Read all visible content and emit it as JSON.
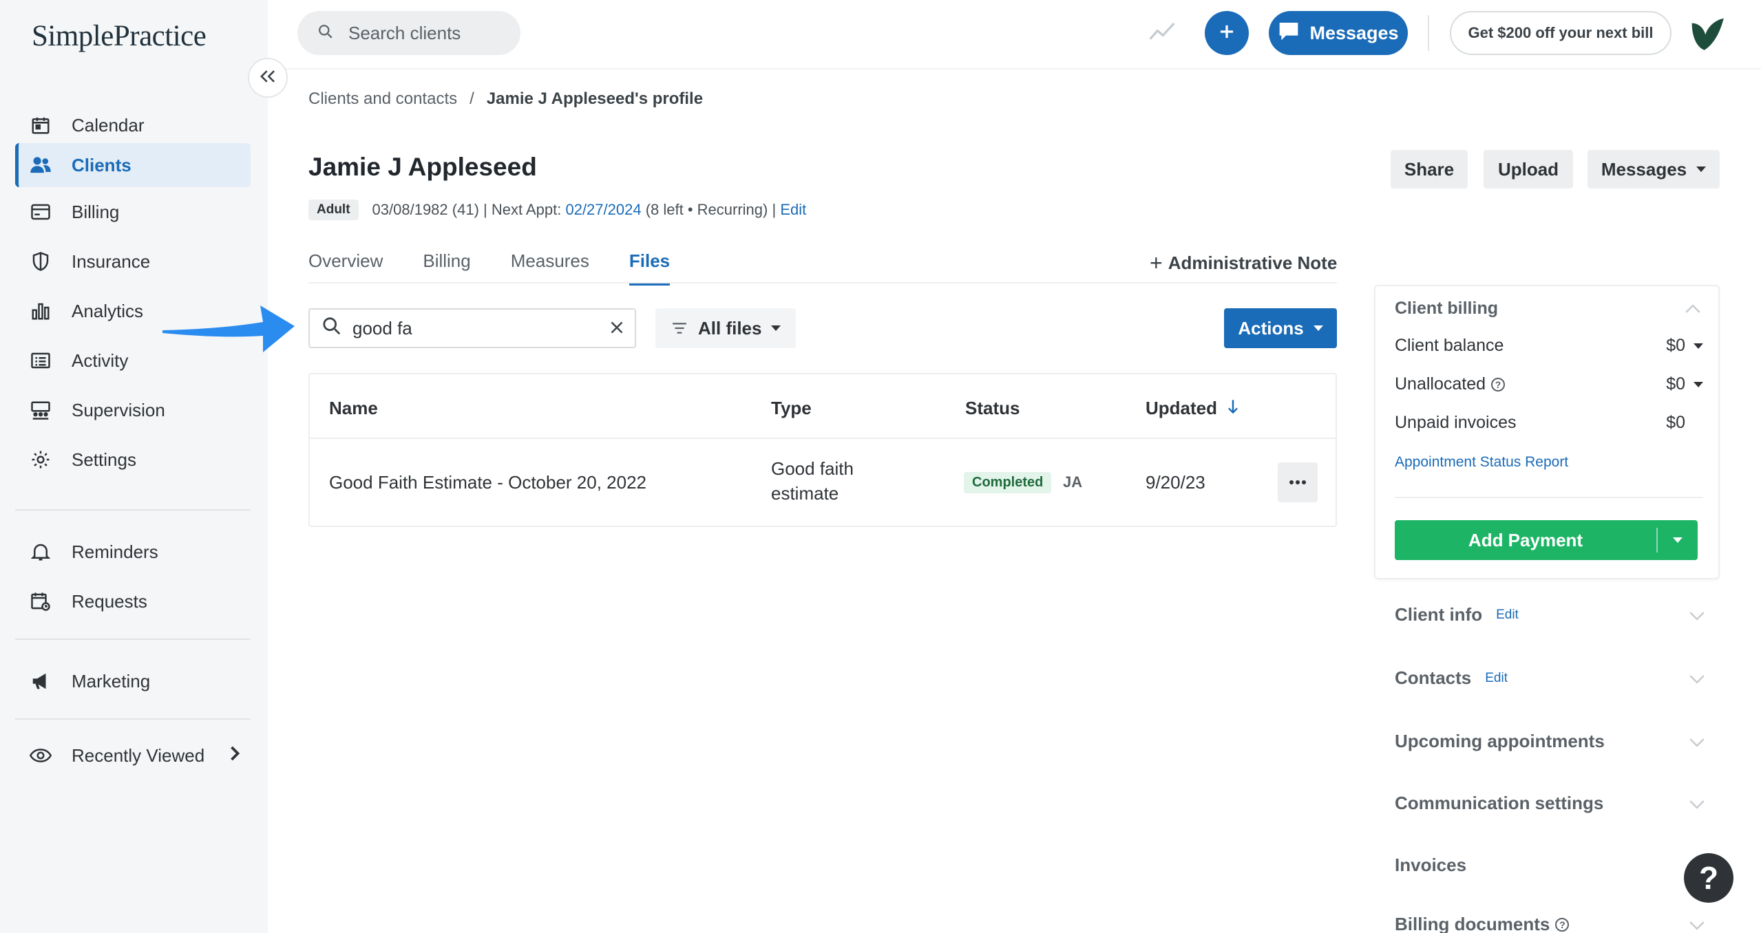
{
  "app": {
    "logo_text": "SimplePractice"
  },
  "sidebar": {
    "items": [
      {
        "label": "Calendar",
        "icon": "calendar-icon"
      },
      {
        "label": "Clients",
        "icon": "users-icon"
      },
      {
        "label": "Billing",
        "icon": "credit-card-icon"
      },
      {
        "label": "Insurance",
        "icon": "shield-icon"
      },
      {
        "label": "Analytics",
        "icon": "bar-chart-icon"
      },
      {
        "label": "Activity",
        "icon": "list-icon"
      },
      {
        "label": "Supervision",
        "icon": "supervision-icon"
      },
      {
        "label": "Settings",
        "icon": "gear-icon"
      },
      {
        "label": "Reminders",
        "icon": "bell-icon"
      },
      {
        "label": "Requests",
        "icon": "calendar-request-icon"
      },
      {
        "label": "Marketing",
        "icon": "megaphone-icon"
      },
      {
        "label": "Recently Viewed",
        "icon": "eye-icon"
      }
    ],
    "active": "Clients"
  },
  "topbar": {
    "search_placeholder": "Search clients",
    "messages_label": "Messages",
    "promo_label": "Get $200 off your next bill"
  },
  "breadcrumb": {
    "parent": "Clients and contacts",
    "separator": "/",
    "current": "Jamie J Appleseed's profile"
  },
  "client": {
    "name": "Jamie J Appleseed",
    "badge": "Adult",
    "dob": "03/08/1982 (41) | Next Appt:",
    "next_appt": "02/27/2024",
    "appt_info": "(8 left • Recurring) |",
    "edit_label": "Edit"
  },
  "header_buttons": {
    "share": "Share",
    "upload": "Upload",
    "messages": "Messages"
  },
  "tabs": [
    {
      "label": "Overview"
    },
    {
      "label": "Billing"
    },
    {
      "label": "Measures"
    },
    {
      "label": "Files"
    }
  ],
  "active_tab": "Files",
  "admin_note": {
    "plus": "+",
    "label": "Administrative Note"
  },
  "files": {
    "search_value": "good fa",
    "filter_label": "All files",
    "actions_label": "Actions",
    "columns": [
      "Name",
      "Type",
      "Status",
      "Updated"
    ],
    "rows": [
      {
        "name": "Good Faith Estimate - October 20, 2022",
        "type_line1": "Good faith",
        "type_line2": "estimate",
        "status": "Completed",
        "initials": "JA",
        "updated": "9/20/23"
      }
    ]
  },
  "billing_panel": {
    "title": "Client billing",
    "client_balance_label": "Client balance",
    "client_balance": "$0",
    "unallocated_label": "Unallocated",
    "unallocated": "$0",
    "unpaid_label": "Unpaid invoices",
    "unpaid": "$0",
    "report_link": "Appointment Status Report",
    "add_payment": "Add Payment"
  },
  "sections": [
    {
      "label": "Client info",
      "edit": "Edit"
    },
    {
      "label": "Contacts",
      "edit": "Edit"
    },
    {
      "label": "Upcoming appointments"
    },
    {
      "label": "Communication settings"
    },
    {
      "label": "Invoices"
    },
    {
      "label": "Billing documents"
    }
  ],
  "help_fab": "?",
  "colors": {
    "primary": "#1a6bb8",
    "success": "#1db565",
    "sidebar_bg": "#f5f6f7",
    "annotation_arrow": "#2b8cf0"
  }
}
